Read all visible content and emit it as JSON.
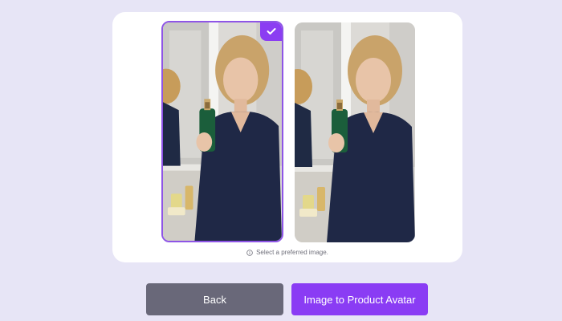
{
  "images": [
    {
      "name": "portrait-option-1",
      "selected": true
    },
    {
      "name": "portrait-option-2",
      "selected": false
    }
  ],
  "hint_text": "Select a preferred image.",
  "buttons": {
    "back_label": "Back",
    "next_label": "Image to Product Avatar"
  },
  "colors": {
    "background": "#e7e5f6",
    "accent": "#8a3cf4",
    "back_button": "#696879",
    "selected_border": "#8e55e6"
  },
  "icons": {
    "selected": "check-icon",
    "hint": "info-icon"
  }
}
